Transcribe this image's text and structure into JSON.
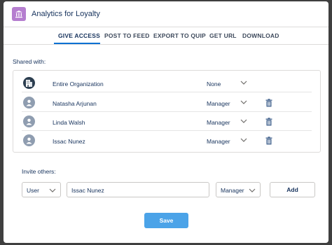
{
  "header": {
    "title": "Analytics for Loyalty",
    "app_icon": "building-icon",
    "app_icon_color": "#b57ecf"
  },
  "tabs": [
    {
      "label": "GIVE ACCESS",
      "active": true
    },
    {
      "label": "POST TO FEED",
      "active": false
    },
    {
      "label": "EXPORT TO QUIP",
      "active": false
    },
    {
      "label": "GET URL",
      "active": false
    },
    {
      "label": "DOWNLOAD",
      "active": false
    }
  ],
  "shared": {
    "label": "Shared with:",
    "rows": [
      {
        "name": "Entire Organization",
        "access": "None",
        "icon": "building-icon",
        "deletable": false
      },
      {
        "name": "Natasha Arjunan",
        "access": "Manager",
        "icon": "user-icon",
        "deletable": true
      },
      {
        "name": "Linda Walsh",
        "access": "Manager",
        "icon": "user-icon",
        "deletable": true
      },
      {
        "name": "Issac Nunez",
        "access": "Manager",
        "icon": "user-icon",
        "deletable": true
      }
    ]
  },
  "invite": {
    "label": "Invite others:",
    "type_value": "User",
    "name_value": "Issac Nunez",
    "access_value": "Manager",
    "add_label": "Add"
  },
  "footer": {
    "save_label": "Save"
  },
  "colors": {
    "accent": "#0070d2",
    "save": "#4ba3e8",
    "trash": "#44648f"
  }
}
